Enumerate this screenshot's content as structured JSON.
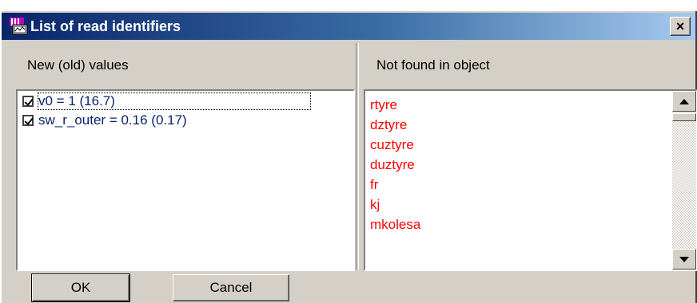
{
  "window": {
    "title": "List of read identifiers",
    "close_symbol": "×",
    "title_gradient_start": "#0a246a",
    "title_gradient_end": "#a6caf0"
  },
  "left_pane": {
    "header": "New (old) values",
    "items": [
      {
        "label": "v0 = 1 (16.7)",
        "checked": true
      },
      {
        "label": "sw_r_outer = 0.16 (0.17)",
        "checked": true
      }
    ],
    "text_color": "#0a246a"
  },
  "right_pane": {
    "header": "Not found in object",
    "items": [
      "rtyre",
      "dztyre",
      "cuztyre",
      "duztyre",
      "fr",
      "kj",
      "mkolesa"
    ],
    "text_color": "#ff0000"
  },
  "buttons": {
    "ok_label": "OK",
    "cancel_label": "Cancel"
  },
  "icons": {
    "app": "app-window-icon",
    "close": "close-icon",
    "scroll_up": "scroll-up-arrow-icon",
    "scroll_down": "scroll-down-arrow-icon",
    "check": "checkmark-icon"
  }
}
